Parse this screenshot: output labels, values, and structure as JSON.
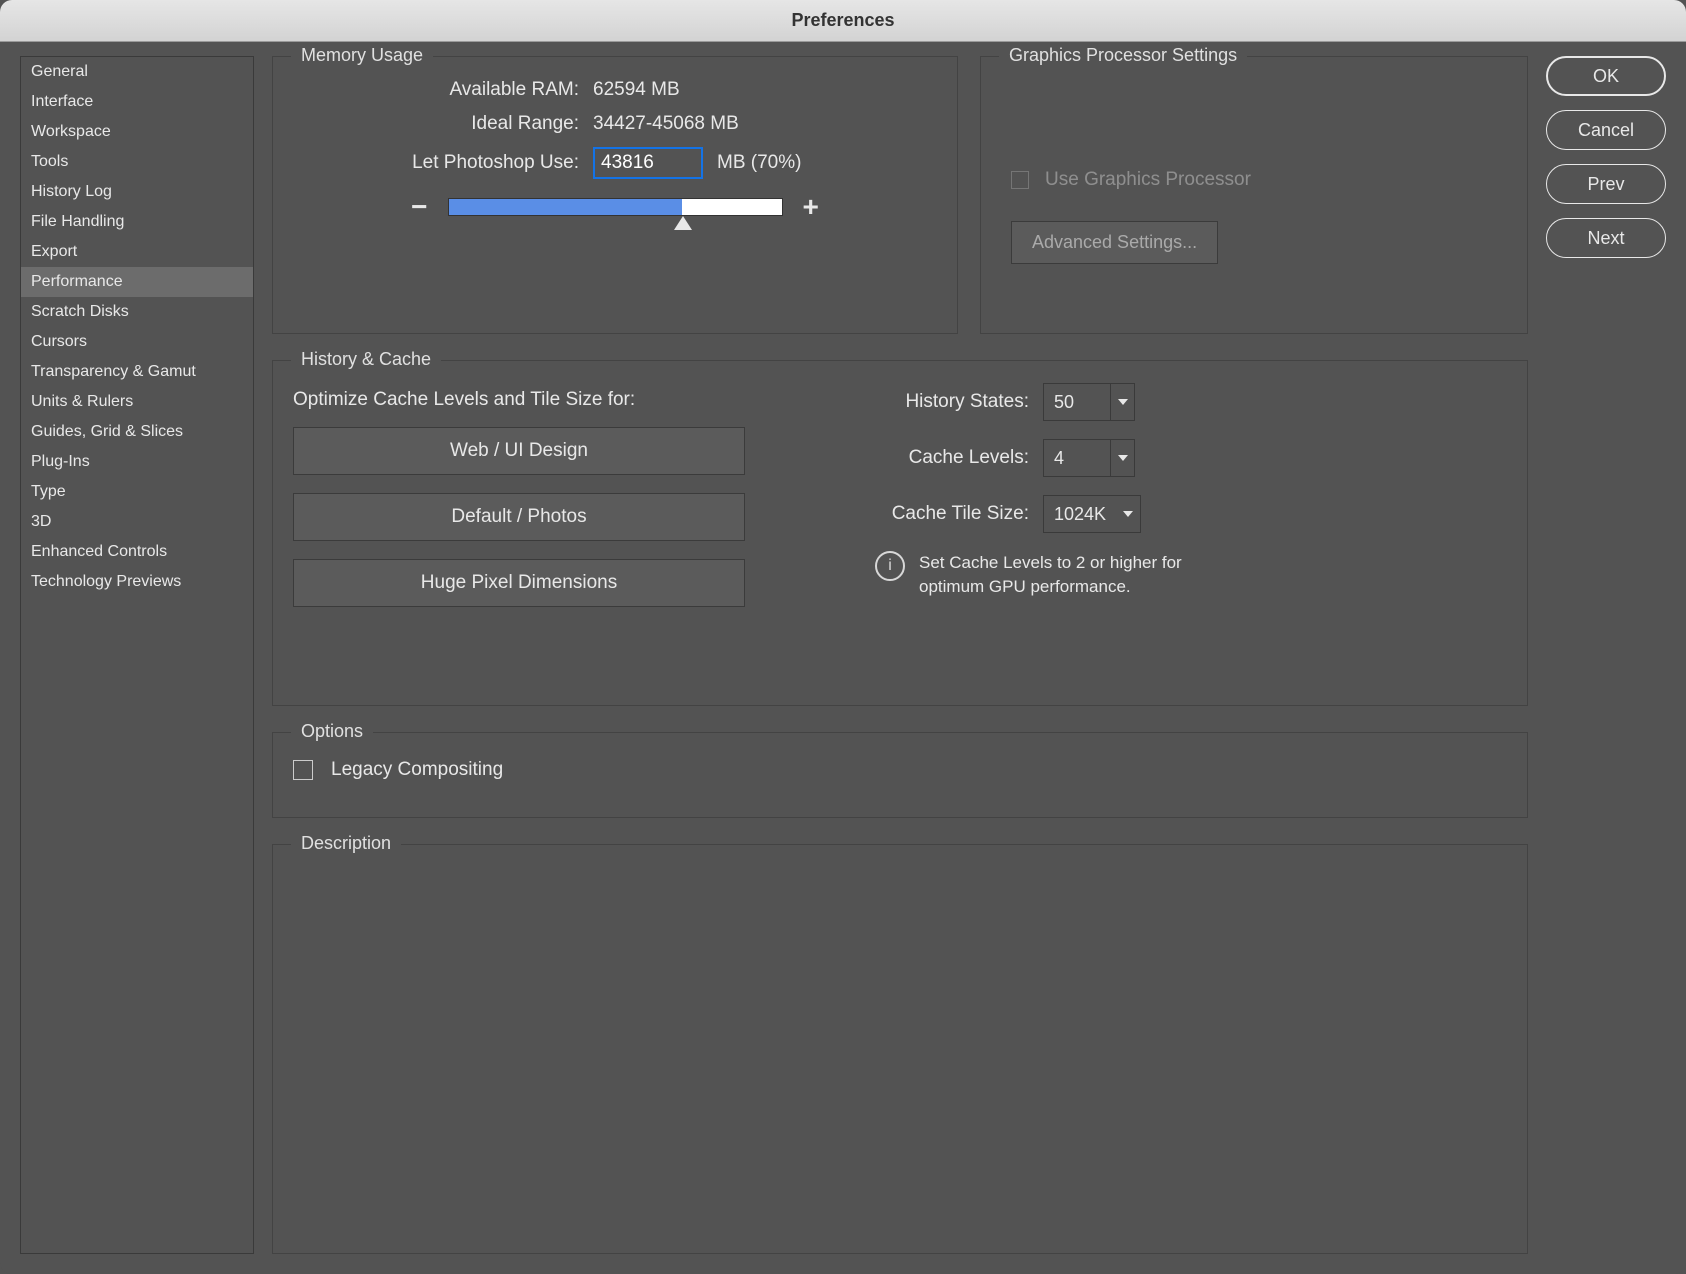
{
  "title": "Preferences",
  "sidebar": {
    "items": [
      "General",
      "Interface",
      "Workspace",
      "Tools",
      "History Log",
      "File Handling",
      "Export",
      "Performance",
      "Scratch Disks",
      "Cursors",
      "Transparency & Gamut",
      "Units & Rulers",
      "Guides, Grid & Slices",
      "Plug-Ins",
      "Type",
      "3D",
      "Enhanced Controls",
      "Technology Previews"
    ],
    "selected": "Performance"
  },
  "buttons": {
    "ok": "OK",
    "cancel": "Cancel",
    "prev": "Prev",
    "next": "Next"
  },
  "memory": {
    "legend": "Memory Usage",
    "available_label": "Available RAM:",
    "available_value": "62594 MB",
    "ideal_label": "Ideal Range:",
    "ideal_value": "34427-45068 MB",
    "use_label": "Let Photoshop Use:",
    "use_value": "43816",
    "use_suffix": "MB (70%)",
    "minus": "−",
    "plus": "+"
  },
  "gpu": {
    "legend": "Graphics Processor Settings",
    "checkbox_label": "Use Graphics Processor",
    "advanced": "Advanced Settings..."
  },
  "history": {
    "legend": "History & Cache",
    "optimize_label": "Optimize Cache Levels and Tile Size for:",
    "presets": [
      "Web / UI Design",
      "Default / Photos",
      "Huge Pixel Dimensions"
    ],
    "states_label": "History States:",
    "states_value": "50",
    "levels_label": "Cache Levels:",
    "levels_value": "4",
    "tile_label": "Cache Tile Size:",
    "tile_value": "1024K",
    "info_text": "Set Cache Levels to 2 or higher for optimum GPU performance."
  },
  "options": {
    "legend": "Options",
    "legacy_label": "Legacy Compositing"
  },
  "description": {
    "legend": "Description"
  }
}
